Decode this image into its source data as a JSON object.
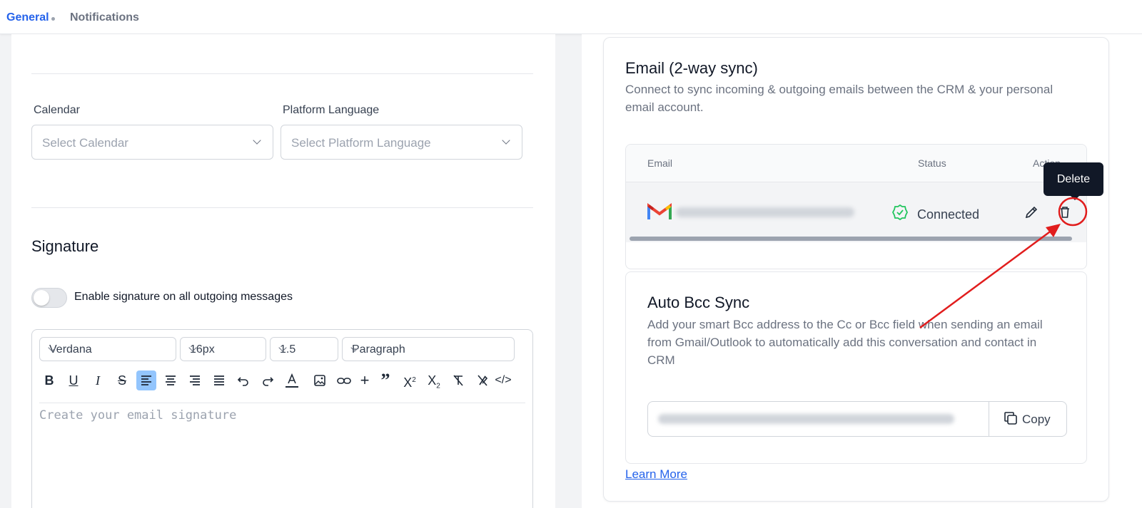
{
  "tabs": {
    "general": "General",
    "notifications": "Notifications"
  },
  "general_form": {
    "calendar_label": "Calendar",
    "calendar_placeholder": "Select Calendar",
    "language_label": "Platform Language",
    "language_placeholder": "Select Platform Language"
  },
  "signature": {
    "title": "Signature",
    "toggle_label": "Enable signature on all outgoing messages",
    "toggle_on": false,
    "font": "Verdana",
    "size": "16px",
    "line_height": "1.5",
    "block": "Paragraph",
    "placeholder": "Create your email signature",
    "toolbar": [
      "bold-icon",
      "underline-icon",
      "italic-icon",
      "strikethrough-icon",
      "align-left-icon",
      "align-center-icon",
      "align-right-icon",
      "align-justify-icon",
      "undo-icon",
      "redo-icon",
      "text-color-icon",
      "image-icon",
      "link-icon",
      "plus-icon",
      "quote-icon",
      "superscript-icon",
      "subscript-icon",
      "clear-format-icon",
      "remove-link-icon",
      "code-icon"
    ]
  },
  "email_sync": {
    "title": "Email (2-way sync)",
    "description": "Connect to sync incoming & outgoing emails between the CRM & your personal email account.",
    "columns": {
      "email": "Email",
      "status": "Status",
      "action": "Action"
    },
    "row": {
      "provider_icon": "gmail-icon",
      "status": "Connected",
      "status_color": "#22c55e"
    },
    "tooltip": "Delete"
  },
  "bcc": {
    "title": "Auto Bcc Sync",
    "description": "Add your smart Bcc address to the Cc or Bcc field when sending an email from Gmail/Outlook to automatically add this conversation and contact in CRM",
    "copy_label": "Copy"
  },
  "learn_more": "Learn More",
  "colors": {
    "accent": "#2563eb",
    "annotation": "#e11d1d",
    "tooltip": "#111827"
  }
}
